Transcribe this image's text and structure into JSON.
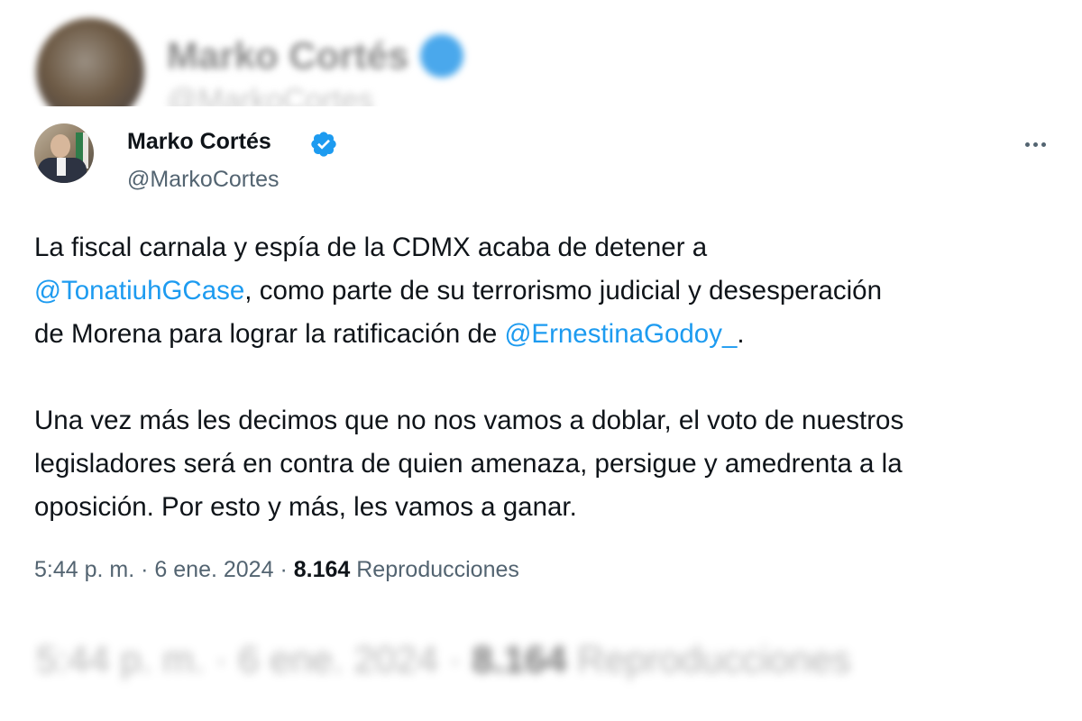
{
  "author": {
    "name": "Marko Cortés",
    "handle": "@MarkoCortes",
    "verified_color": "#1d9bf0"
  },
  "tweet": {
    "paragraph1": {
      "line1": "La fiscal carnala y espía de la CDMX acaba de detener a",
      "line2_mention": "@TonatiuhGCase",
      "line2_rest": ", como parte de su terrorismo judicial y desesperación",
      "line3_start": "de Morena para lograr la ratificación de ",
      "line3_mention": "@ErnestinaGodoy_",
      "line3_end": "."
    },
    "paragraph2": {
      "line1": "Una vez más les decimos que no nos vamos a doblar, el voto de nuestros",
      "line2": "legisladores será en contra de quien amenaza, persigue y amedrenta a la",
      "line3": "oposición. Por esto y más, les vamos a ganar."
    }
  },
  "meta": {
    "time": "5:44 p. m.",
    "separator": "·",
    "date": "6 ene. 2024",
    "views_count": "8.164",
    "views_label": "Reproducciones"
  },
  "icons": {
    "verified": "verified-badge-icon",
    "more": "more-options-icon"
  }
}
